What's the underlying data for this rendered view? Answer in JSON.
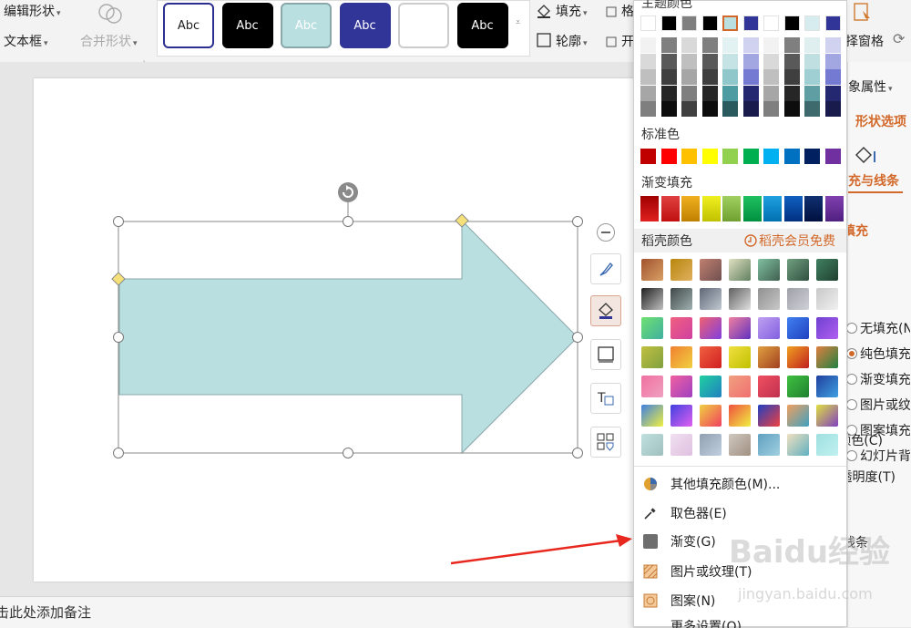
{
  "ribbon": {
    "edit_shape": "编辑形状",
    "text_box": "文本框",
    "merge_shape": "合并形状",
    "fill": "填充",
    "outline": "轮廓",
    "truncated_1": "格",
    "truncated_2": "开",
    "select_pane": "择窗格",
    "style_label": "Abc",
    "styles": [
      {
        "bg": "#ffffff",
        "border": "#2b2f8f",
        "fg": "#222222"
      },
      {
        "bg": "#000000",
        "border": "#000000",
        "fg": "#ffffff"
      },
      {
        "bg": "#b9dfe1",
        "border": "#8aa7aa",
        "fg": "#ffffff"
      },
      {
        "bg": "#303597",
        "border": "#303597",
        "fg": "#ffffff"
      },
      {
        "bg": "#ffffff",
        "border": "#cccccc",
        "fg": "#ffffff"
      },
      {
        "bg": "#000000",
        "border": "#000000",
        "fg": "#ffffff"
      }
    ]
  },
  "shape": {
    "fill": "#b9dfe1",
    "stroke": "#8aa7aa"
  },
  "notes": {
    "placeholder": "单击此处添加备注"
  },
  "right_pane": {
    "object_props": "象属性",
    "shape_options": "形状选项",
    "fill_line": "充与线条",
    "fill_header": "填充",
    "options": [
      "无填充(N)",
      "纯色填充(S)",
      "渐变填充(G)",
      "图片或纹理填充(P)",
      "图案填充(A)",
      "幻灯片背景填充(B)"
    ],
    "color": "颜色(C)",
    "transparency": "透明度(T)",
    "line": "线条"
  },
  "dropdown": {
    "theme_colors": "主题颜色",
    "standard_colors": "标准色",
    "gradient_fill": "渐变填充",
    "shell_colors": "稻壳颜色",
    "member_free": "稻壳会员免费",
    "theme_top": [
      "#ffffff",
      "#000000",
      "#7f7f7f",
      "#000000",
      "#b9dfe1",
      "#303597",
      "#ffffff",
      "#000000",
      "#d7ecee",
      "#303597"
    ],
    "theme_cols": [
      [
        "#f2f2f2",
        "#d9d9d9",
        "#bfbfbf",
        "#a6a6a6",
        "#7f7f7f"
      ],
      [
        "#7f7f7f",
        "#595959",
        "#3f3f3f",
        "#262626",
        "#0d0d0d"
      ],
      [
        "#d9d9d9",
        "#bfbfbf",
        "#a6a6a6",
        "#7f7f7f",
        "#404040"
      ],
      [
        "#7f7f7f",
        "#595959",
        "#3f3f3f",
        "#262626",
        "#0d0d0d"
      ],
      [
        "#e2f1f2",
        "#c5e3e5",
        "#8fc7cb",
        "#4d9ca2",
        "#2a5a5d"
      ],
      [
        "#d0d2f0",
        "#a2a6e1",
        "#7479d2",
        "#242871",
        "#181b4b"
      ],
      [
        "#f2f2f2",
        "#d9d9d9",
        "#bfbfbf",
        "#a6a6a6",
        "#7f7f7f"
      ],
      [
        "#7f7f7f",
        "#595959",
        "#3f3f3f",
        "#262626",
        "#0d0d0d"
      ],
      [
        "#dfeff0",
        "#bfdfe1",
        "#9fcfd2",
        "#5f9fa3",
        "#3f6a6d"
      ],
      [
        "#d0d2f0",
        "#a2a6e1",
        "#7479d2",
        "#242871",
        "#181b4b"
      ]
    ],
    "standard": [
      "#c00000",
      "#ff0000",
      "#ffc000",
      "#ffff00",
      "#92d050",
      "#00b050",
      "#00b0f0",
      "#0070c0",
      "#002060",
      "#7030a0"
    ],
    "gradients": [
      [
        "#a00000",
        "#e02020"
      ],
      [
        "#e04040",
        "#c01010"
      ],
      [
        "#f0b020",
        "#c08000"
      ],
      [
        "#f0f020",
        "#c0c000"
      ],
      [
        "#a0d060",
        "#70a030"
      ],
      [
        "#20c060",
        "#009040"
      ],
      [
        "#20a0e0",
        "#0070b0"
      ],
      [
        "#1060c0",
        "#003080"
      ],
      [
        "#103070",
        "#001040"
      ],
      [
        "#8040b0",
        "#502080"
      ]
    ],
    "shell": [
      [
        "#a0522d",
        "#d9a066"
      ],
      [
        "#b8860b",
        "#e0b060"
      ],
      [
        "#c08070",
        "#705050"
      ],
      [
        "#e0e0c0",
        "#608060"
      ],
      [
        "#80c0a0",
        "#406050"
      ],
      [
        "#70a080",
        "#305040"
      ],
      [
        "#408060",
        "#204030"
      ],
      [
        "#202020",
        "#c0c0c0"
      ],
      [
        "#404848",
        "#a0b0b0"
      ],
      [
        "#606878",
        "#c0c8d0"
      ],
      [
        "#606060",
        "#e0e0e0"
      ],
      [
        "#909090",
        "#c8c8c8"
      ],
      [
        "#a0a0a8",
        "#d0d0d8"
      ],
      [
        "#c8c8c8",
        "#f0f0f0"
      ],
      [
        "#70e070",
        "#40b0a0"
      ],
      [
        "#f06080",
        "#d040a0"
      ],
      [
        "#f06070",
        "#8040e0"
      ],
      [
        "#f080a0",
        "#6030c0"
      ],
      [
        "#c0a0f0",
        "#8060e0"
      ],
      [
        "#4080f0",
        "#2040c0"
      ],
      [
        "#7040d0",
        "#b060f0"
      ],
      [
        "#c0c040",
        "#80a040"
      ],
      [
        "#f08030",
        "#f0d040"
      ],
      [
        "#f06040",
        "#d02020"
      ],
      [
        "#f0e040",
        "#c0c000"
      ],
      [
        "#e0a040",
        "#a04020"
      ],
      [
        "#f0a020",
        "#c02020"
      ],
      [
        "#e08040",
        "#208040"
      ],
      [
        "#f070a0",
        "#f0a0c0"
      ],
      [
        "#f060a0",
        "#a040c0"
      ],
      [
        "#20d0a0",
        "#2080c0"
      ],
      [
        "#f0a080",
        "#f07070"
      ],
      [
        "#f05060",
        "#c03050"
      ],
      [
        "#40c040",
        "#208030"
      ],
      [
        "#2040a0",
        "#40a0e0"
      ],
      [
        "#4080e0",
        "#f0f040"
      ],
      [
        "#4040e0",
        "#e060f0"
      ],
      [
        "#f0d040",
        "#f04060"
      ],
      [
        "#f05040",
        "#f0f040"
      ],
      [
        "#2040c0",
        "#f04040"
      ],
      [
        "#f0a060",
        "#40a0c0"
      ],
      [
        "#e0e040",
        "#8040c0"
      ],
      [
        "#c0e0e0",
        "#a0c0c0"
      ],
      [
        "#f0e0f0",
        "#e0c0e0"
      ],
      [
        "#90a0b0",
        "#c0d0e0"
      ],
      [
        "#d0c8c0",
        "#a09080"
      ],
      [
        "#60a0c0",
        "#a0d0e0"
      ],
      [
        "#f0e0c0",
        "#60b0c0"
      ],
      [
        "#a0e0e0",
        "#c0f0f0"
      ]
    ],
    "more_colors": "其他填充颜色(M)...",
    "eyedropper": "取色器(E)",
    "gradient": "渐变(G)",
    "picture_texture": "图片或纹理(T)",
    "pattern": "图案(N)",
    "more_settings": "更多设置(O)..."
  },
  "watermark": {
    "brand": "Baidu经验",
    "url": "jingyan.baidu.com"
  }
}
